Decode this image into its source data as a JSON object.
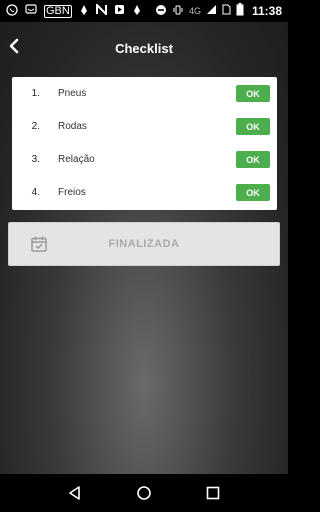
{
  "status_bar": {
    "left_icons": [
      "whatsapp-icon",
      "sms-icon",
      "gbn-icon",
      "flame-icon",
      "n-icon",
      "play-store-icon",
      "flame-icon"
    ],
    "gbn_label": "GBN",
    "network": "4G",
    "time": "11:38"
  },
  "header": {
    "title": "Checklist"
  },
  "checklist": {
    "items": [
      {
        "number": "1.",
        "label": "Pneus",
        "button": "OK"
      },
      {
        "number": "2.",
        "label": "Rodas",
        "button": "OK"
      },
      {
        "number": "3.",
        "label": "Relação",
        "button": "OK"
      },
      {
        "number": "4.",
        "label": "Freios",
        "button": "OK"
      }
    ]
  },
  "finalize": {
    "label": "FINALIZADA"
  },
  "colors": {
    "ok_green": "#4cae4c",
    "finalize_bg": "#e4e4e4",
    "finalize_text": "#aaaaaa"
  }
}
